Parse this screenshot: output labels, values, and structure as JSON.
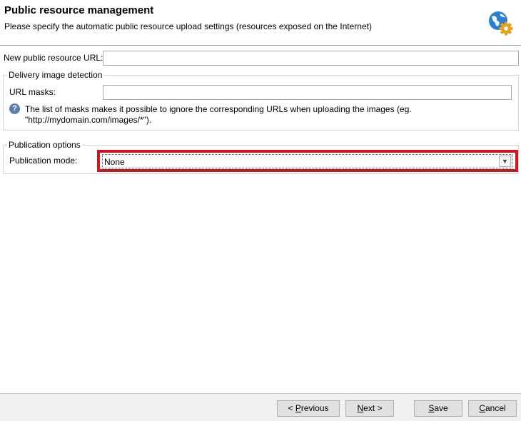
{
  "header": {
    "title": "Public resource management",
    "subtitle": "Please specify the automatic public resource upload settings (resources exposed on the Internet)",
    "icon": "globe-gear-icon"
  },
  "form": {
    "new_url_label": "New public resource URL:",
    "new_url_value": "",
    "delivery_group_title": "Delivery image detection",
    "url_masks_label": "URL masks:",
    "url_masks_value": "",
    "help_line1": "The list of masks makes it possible to ignore the corresponding URLs when uploading the images (eg.",
    "help_line2": "\"http://mydomain.com/images/*\").",
    "publication_group_title": "Publication options",
    "publication_mode_label": "Publication mode:",
    "publication_mode_value": "None",
    "highlight_color": "#d0151f"
  },
  "footer": {
    "previous_prefix": "< ",
    "previous_accel": "P",
    "previous_rest": "revious",
    "next_accel": "N",
    "next_rest": "ext >",
    "save_accel": "S",
    "save_rest": "ave",
    "cancel_accel": "C",
    "cancel_rest": "ancel"
  }
}
